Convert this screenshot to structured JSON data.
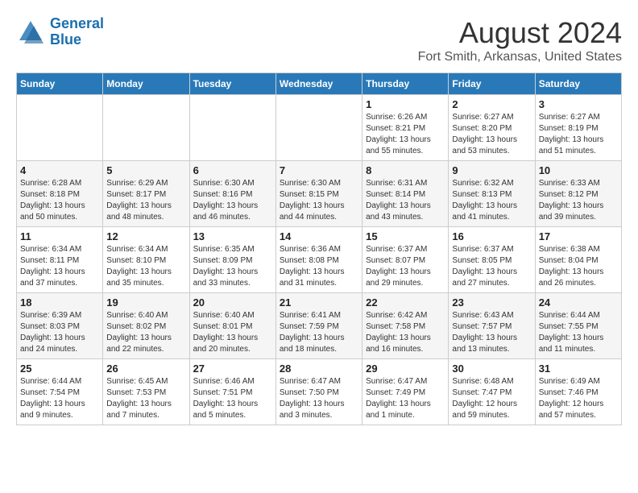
{
  "header": {
    "logo_line1": "General",
    "logo_line2": "Blue",
    "main_title": "August 2024",
    "subtitle": "Fort Smith, Arkansas, United States"
  },
  "days_of_week": [
    "Sunday",
    "Monday",
    "Tuesday",
    "Wednesday",
    "Thursday",
    "Friday",
    "Saturday"
  ],
  "weeks": [
    [
      {
        "day": "",
        "info": ""
      },
      {
        "day": "",
        "info": ""
      },
      {
        "day": "",
        "info": ""
      },
      {
        "day": "",
        "info": ""
      },
      {
        "day": "1",
        "info": "Sunrise: 6:26 AM\nSunset: 8:21 PM\nDaylight: 13 hours\nand 55 minutes."
      },
      {
        "day": "2",
        "info": "Sunrise: 6:27 AM\nSunset: 8:20 PM\nDaylight: 13 hours\nand 53 minutes."
      },
      {
        "day": "3",
        "info": "Sunrise: 6:27 AM\nSunset: 8:19 PM\nDaylight: 13 hours\nand 51 minutes."
      }
    ],
    [
      {
        "day": "4",
        "info": "Sunrise: 6:28 AM\nSunset: 8:18 PM\nDaylight: 13 hours\nand 50 minutes."
      },
      {
        "day": "5",
        "info": "Sunrise: 6:29 AM\nSunset: 8:17 PM\nDaylight: 13 hours\nand 48 minutes."
      },
      {
        "day": "6",
        "info": "Sunrise: 6:30 AM\nSunset: 8:16 PM\nDaylight: 13 hours\nand 46 minutes."
      },
      {
        "day": "7",
        "info": "Sunrise: 6:30 AM\nSunset: 8:15 PM\nDaylight: 13 hours\nand 44 minutes."
      },
      {
        "day": "8",
        "info": "Sunrise: 6:31 AM\nSunset: 8:14 PM\nDaylight: 13 hours\nand 43 minutes."
      },
      {
        "day": "9",
        "info": "Sunrise: 6:32 AM\nSunset: 8:13 PM\nDaylight: 13 hours\nand 41 minutes."
      },
      {
        "day": "10",
        "info": "Sunrise: 6:33 AM\nSunset: 8:12 PM\nDaylight: 13 hours\nand 39 minutes."
      }
    ],
    [
      {
        "day": "11",
        "info": "Sunrise: 6:34 AM\nSunset: 8:11 PM\nDaylight: 13 hours\nand 37 minutes."
      },
      {
        "day": "12",
        "info": "Sunrise: 6:34 AM\nSunset: 8:10 PM\nDaylight: 13 hours\nand 35 minutes."
      },
      {
        "day": "13",
        "info": "Sunrise: 6:35 AM\nSunset: 8:09 PM\nDaylight: 13 hours\nand 33 minutes."
      },
      {
        "day": "14",
        "info": "Sunrise: 6:36 AM\nSunset: 8:08 PM\nDaylight: 13 hours\nand 31 minutes."
      },
      {
        "day": "15",
        "info": "Sunrise: 6:37 AM\nSunset: 8:07 PM\nDaylight: 13 hours\nand 29 minutes."
      },
      {
        "day": "16",
        "info": "Sunrise: 6:37 AM\nSunset: 8:05 PM\nDaylight: 13 hours\nand 27 minutes."
      },
      {
        "day": "17",
        "info": "Sunrise: 6:38 AM\nSunset: 8:04 PM\nDaylight: 13 hours\nand 26 minutes."
      }
    ],
    [
      {
        "day": "18",
        "info": "Sunrise: 6:39 AM\nSunset: 8:03 PM\nDaylight: 13 hours\nand 24 minutes."
      },
      {
        "day": "19",
        "info": "Sunrise: 6:40 AM\nSunset: 8:02 PM\nDaylight: 13 hours\nand 22 minutes."
      },
      {
        "day": "20",
        "info": "Sunrise: 6:40 AM\nSunset: 8:01 PM\nDaylight: 13 hours\nand 20 minutes."
      },
      {
        "day": "21",
        "info": "Sunrise: 6:41 AM\nSunset: 7:59 PM\nDaylight: 13 hours\nand 18 minutes."
      },
      {
        "day": "22",
        "info": "Sunrise: 6:42 AM\nSunset: 7:58 PM\nDaylight: 13 hours\nand 16 minutes."
      },
      {
        "day": "23",
        "info": "Sunrise: 6:43 AM\nSunset: 7:57 PM\nDaylight: 13 hours\nand 13 minutes."
      },
      {
        "day": "24",
        "info": "Sunrise: 6:44 AM\nSunset: 7:55 PM\nDaylight: 13 hours\nand 11 minutes."
      }
    ],
    [
      {
        "day": "25",
        "info": "Sunrise: 6:44 AM\nSunset: 7:54 PM\nDaylight: 13 hours\nand 9 minutes."
      },
      {
        "day": "26",
        "info": "Sunrise: 6:45 AM\nSunset: 7:53 PM\nDaylight: 13 hours\nand 7 minutes."
      },
      {
        "day": "27",
        "info": "Sunrise: 6:46 AM\nSunset: 7:51 PM\nDaylight: 13 hours\nand 5 minutes."
      },
      {
        "day": "28",
        "info": "Sunrise: 6:47 AM\nSunset: 7:50 PM\nDaylight: 13 hours\nand 3 minutes."
      },
      {
        "day": "29",
        "info": "Sunrise: 6:47 AM\nSunset: 7:49 PM\nDaylight: 13 hours\nand 1 minute."
      },
      {
        "day": "30",
        "info": "Sunrise: 6:48 AM\nSunset: 7:47 PM\nDaylight: 12 hours\nand 59 minutes."
      },
      {
        "day": "31",
        "info": "Sunrise: 6:49 AM\nSunset: 7:46 PM\nDaylight: 12 hours\nand 57 minutes."
      }
    ]
  ]
}
